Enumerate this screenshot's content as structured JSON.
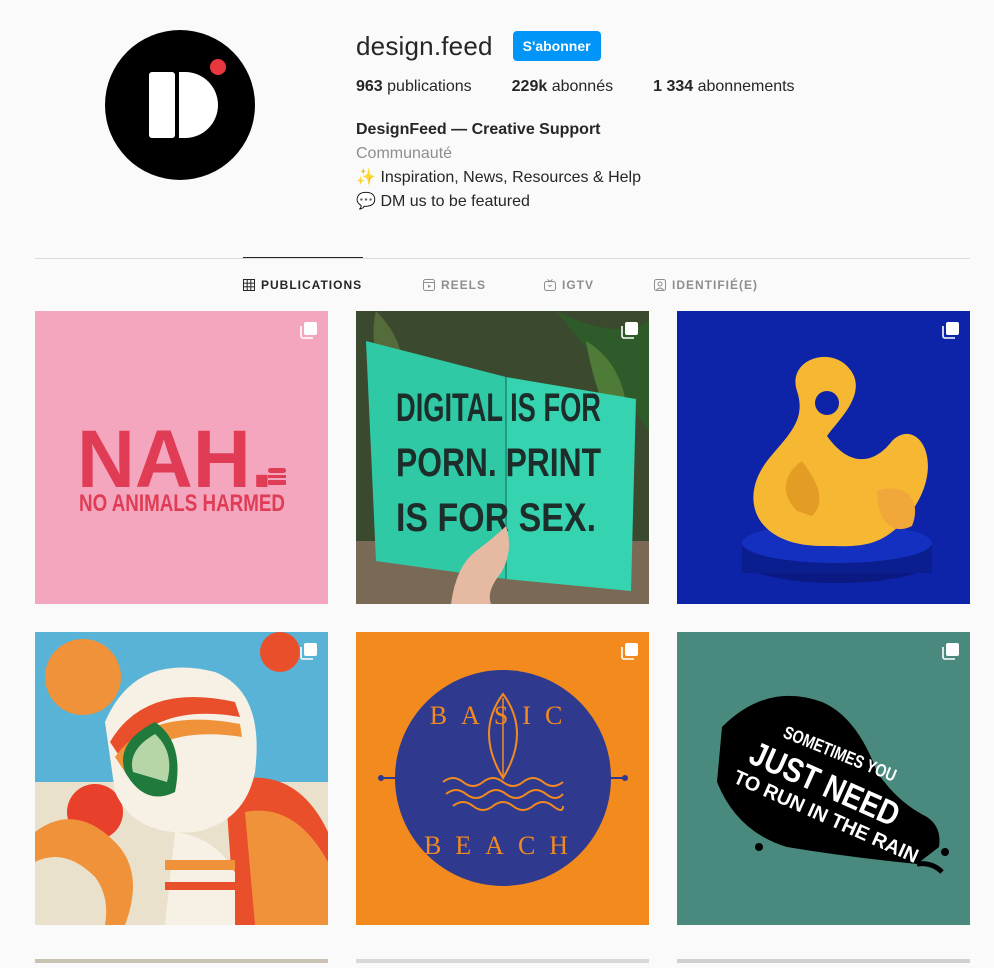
{
  "profile": {
    "username": "design.feed",
    "follow_label": "S'abonner",
    "stats": [
      {
        "value": "963",
        "label": "publications"
      },
      {
        "value": "229k",
        "label": "abonnés"
      },
      {
        "value": "1 334",
        "label": "abonnements"
      }
    ],
    "bio": {
      "name": "DesignFeed — Creative Support",
      "category": "Communauté",
      "line1_emoji": "✨",
      "line1": "Inspiration, News, Resources & Help",
      "line2_emoji": "💬",
      "line2": "DM us to be featured"
    }
  },
  "tabs": [
    {
      "label": "PUBLICATIONS",
      "icon": "grid-icon",
      "active": true
    },
    {
      "label": "REELS",
      "icon": "reels-icon",
      "active": false
    },
    {
      "label": "IGTV",
      "icon": "igtv-icon",
      "active": false
    },
    {
      "label": "IDENTIFIÉ(E)",
      "icon": "tagged-icon",
      "active": false
    }
  ],
  "posts": [
    {
      "bg": "#f3a6bd",
      "text_main": "NAH.",
      "text_sub": "NO ANIMALS HARMED",
      "text_color": "#e03c55"
    },
    {
      "bg": "#2fc9a6",
      "lines": [
        "DIGITAL IS FOR",
        "PORN. PRINT",
        "IS FOR SEX."
      ]
    },
    {
      "bg": "#0d23a8",
      "subject": "yellow ampersand"
    },
    {
      "bg": "#e9e1cc",
      "subject": "astronaut helmet illustration"
    },
    {
      "bg": "#f28a1e",
      "text_top": "BASIC",
      "text_bottom": "BEACH",
      "accent": "#2f3a8f"
    },
    {
      "bg": "#4a8a7e",
      "lines": [
        "SOMETIMES YOU",
        "JUST NEED",
        "TO RUN IN THE RAIN"
      ]
    }
  ],
  "colors": {
    "accent": "#0095f6",
    "text": "#262626",
    "muted": "#8e8e8e"
  }
}
